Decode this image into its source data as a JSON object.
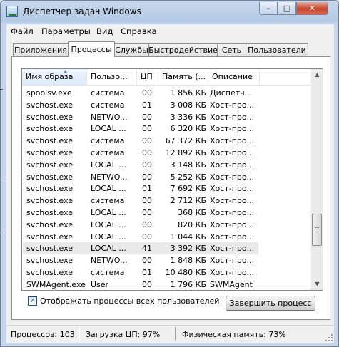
{
  "window": {
    "title": "Диспетчер задач Windows",
    "minimize": "–",
    "maximize": "□",
    "close": "✕"
  },
  "menu": [
    "Файл",
    "Параметры",
    "Вид",
    "Справка"
  ],
  "tabs": [
    "Приложения",
    "Процессы",
    "Службы",
    "Быстродействие",
    "Сеть",
    "Пользователи"
  ],
  "active_tab": "Процессы",
  "columns": {
    "name": "Имя образа",
    "user": "Пользо...",
    "cpu": "ЦП",
    "memory": "Память (...",
    "description": "Описание"
  },
  "sort_arrow": "▲",
  "processes": [
    {
      "name": "spoolsv.exe",
      "user": "система",
      "cpu": "00",
      "memory": "1 856 КБ",
      "desc": "Диспетч..."
    },
    {
      "name": "svchost.exe",
      "user": "система",
      "cpu": "01",
      "memory": "3 008 КБ",
      "desc": "Хост-про..."
    },
    {
      "name": "svchost.exe",
      "user": "NETWO...",
      "cpu": "00",
      "memory": "3 336 КБ",
      "desc": "Хост-про..."
    },
    {
      "name": "svchost.exe",
      "user": "LOCAL ...",
      "cpu": "00",
      "memory": "6 320 КБ",
      "desc": "Хост-про..."
    },
    {
      "name": "svchost.exe",
      "user": "система",
      "cpu": "00",
      "memory": "67 372 КБ",
      "desc": "Хост-про..."
    },
    {
      "name": "svchost.exe",
      "user": "система",
      "cpu": "00",
      "memory": "12 892 КБ",
      "desc": "Хост-про..."
    },
    {
      "name": "svchost.exe",
      "user": "LOCAL ...",
      "cpu": "00",
      "memory": "3 148 КБ",
      "desc": "Хост-про..."
    },
    {
      "name": "svchost.exe",
      "user": "NETWO...",
      "cpu": "00",
      "memory": "5 252 КБ",
      "desc": "Хост-про..."
    },
    {
      "name": "svchost.exe",
      "user": "LOCAL ...",
      "cpu": "01",
      "memory": "7 692 КБ",
      "desc": "Хост-про..."
    },
    {
      "name": "svchost.exe",
      "user": "система",
      "cpu": "00",
      "memory": "2 712 КБ",
      "desc": "Хост-про..."
    },
    {
      "name": "svchost.exe",
      "user": "LOCAL ...",
      "cpu": "00",
      "memory": "368 КБ",
      "desc": "Хост-про..."
    },
    {
      "name": "svchost.exe",
      "user": "LOCAL ...",
      "cpu": "00",
      "memory": "820 КБ",
      "desc": "Хост-про..."
    },
    {
      "name": "svchost.exe",
      "user": "LOCAL ...",
      "cpu": "00",
      "memory": "1 044 КБ",
      "desc": "Хост-про..."
    },
    {
      "name": "svchost.exe",
      "user": "LOCAL ...",
      "cpu": "41",
      "memory": "3 392 КБ",
      "desc": "Хост-про..."
    },
    {
      "name": "svchost.exe",
      "user": "NETWO...",
      "cpu": "00",
      "memory": "1 848 КБ",
      "desc": "Хост-про..."
    },
    {
      "name": "svchost.exe",
      "user": "система",
      "cpu": "01",
      "memory": "10 480 КБ",
      "desc": "Хост-про..."
    },
    {
      "name": "SWMAgent.exe",
      "user": "User",
      "cpu": "00",
      "memory": "1 796 КБ",
      "desc": "SWMAgent"
    }
  ],
  "selected_process": "svchost.exe (CPU 41)",
  "scrollbar": {
    "up_arrow": "▲",
    "down_arrow": "▼"
  },
  "show_all_users": {
    "label": "Отображать процессы всех пользователей",
    "checked": true,
    "mark": "✓"
  },
  "end_process_button": "Завершить процесс",
  "status": {
    "processes": "Процессов: 103",
    "cpu": "Загрузка ЦП: 97%",
    "memory": "Физическая память: 73%"
  }
}
